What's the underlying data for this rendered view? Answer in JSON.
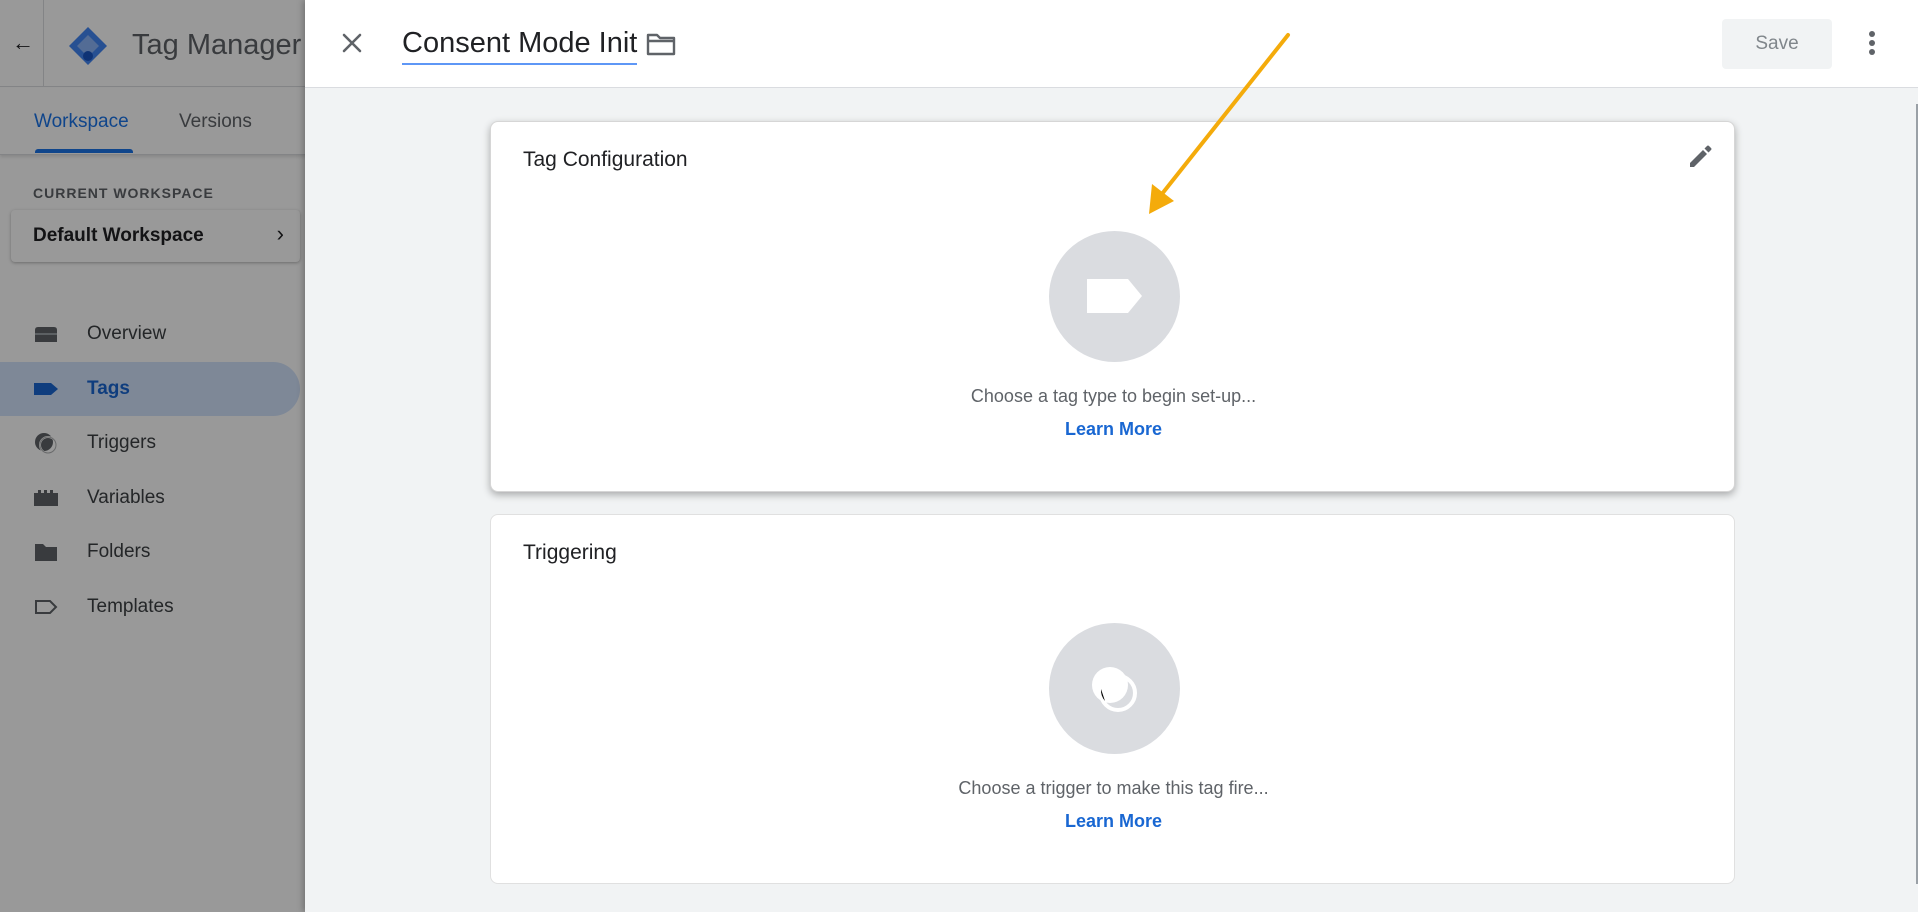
{
  "sidebar": {
    "app_title": "Tag Manager",
    "tabs": [
      {
        "label": "Workspace",
        "active": true
      },
      {
        "label": "Versions",
        "active": false
      }
    ],
    "workspace_label": "CURRENT WORKSPACE",
    "workspace_name": "Default Workspace",
    "items": [
      {
        "label": "Overview",
        "icon": "overview-icon",
        "active": false
      },
      {
        "label": "Tags",
        "icon": "tag-icon",
        "active": true
      },
      {
        "label": "Triggers",
        "icon": "trigger-icon",
        "active": false
      },
      {
        "label": "Variables",
        "icon": "variables-icon",
        "active": false
      },
      {
        "label": "Folders",
        "icon": "folder-icon",
        "active": false
      },
      {
        "label": "Templates",
        "icon": "template-icon",
        "active": false
      }
    ]
  },
  "editor": {
    "tag_name": "Consent Mode Init",
    "save_label": "Save",
    "tag_config": {
      "title": "Tag Configuration",
      "hint": "Choose a tag type to begin set-up...",
      "learn_more": "Learn More"
    },
    "triggering": {
      "title": "Triggering",
      "hint": "Choose a trigger to make this tag fire...",
      "learn_more": "Learn More"
    }
  },
  "colors": {
    "accent": "#1a73e8",
    "link": "#1967d2",
    "annotation_arrow": "#f4ab0b",
    "icon_circle": "#dadce0"
  }
}
